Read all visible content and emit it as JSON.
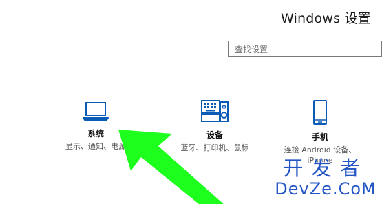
{
  "window": {
    "title": "Windows 设置"
  },
  "search": {
    "placeholder": "查找设置"
  },
  "tiles": [
    {
      "icon": "laptop-icon",
      "name": "系统",
      "desc_lines": [
        "显示、通知、电源"
      ]
    },
    {
      "icon": "keyboard-speaker-icon",
      "name": "设备",
      "desc_lines": [
        "蓝牙、打印机、鼠标"
      ]
    },
    {
      "icon": "phone-icon",
      "name": "手机",
      "desc_lines": [
        "连接 Android 设备、",
        "iPhone"
      ]
    }
  ],
  "annotation": {
    "arrow_color": "#1dff1d",
    "arrow_target": "系统"
  },
  "watermark": {
    "cn": "开发者",
    "en": "DevZe.CoM",
    "color": "#2455c4"
  },
  "colors": {
    "accent": "#0a5bb5"
  }
}
